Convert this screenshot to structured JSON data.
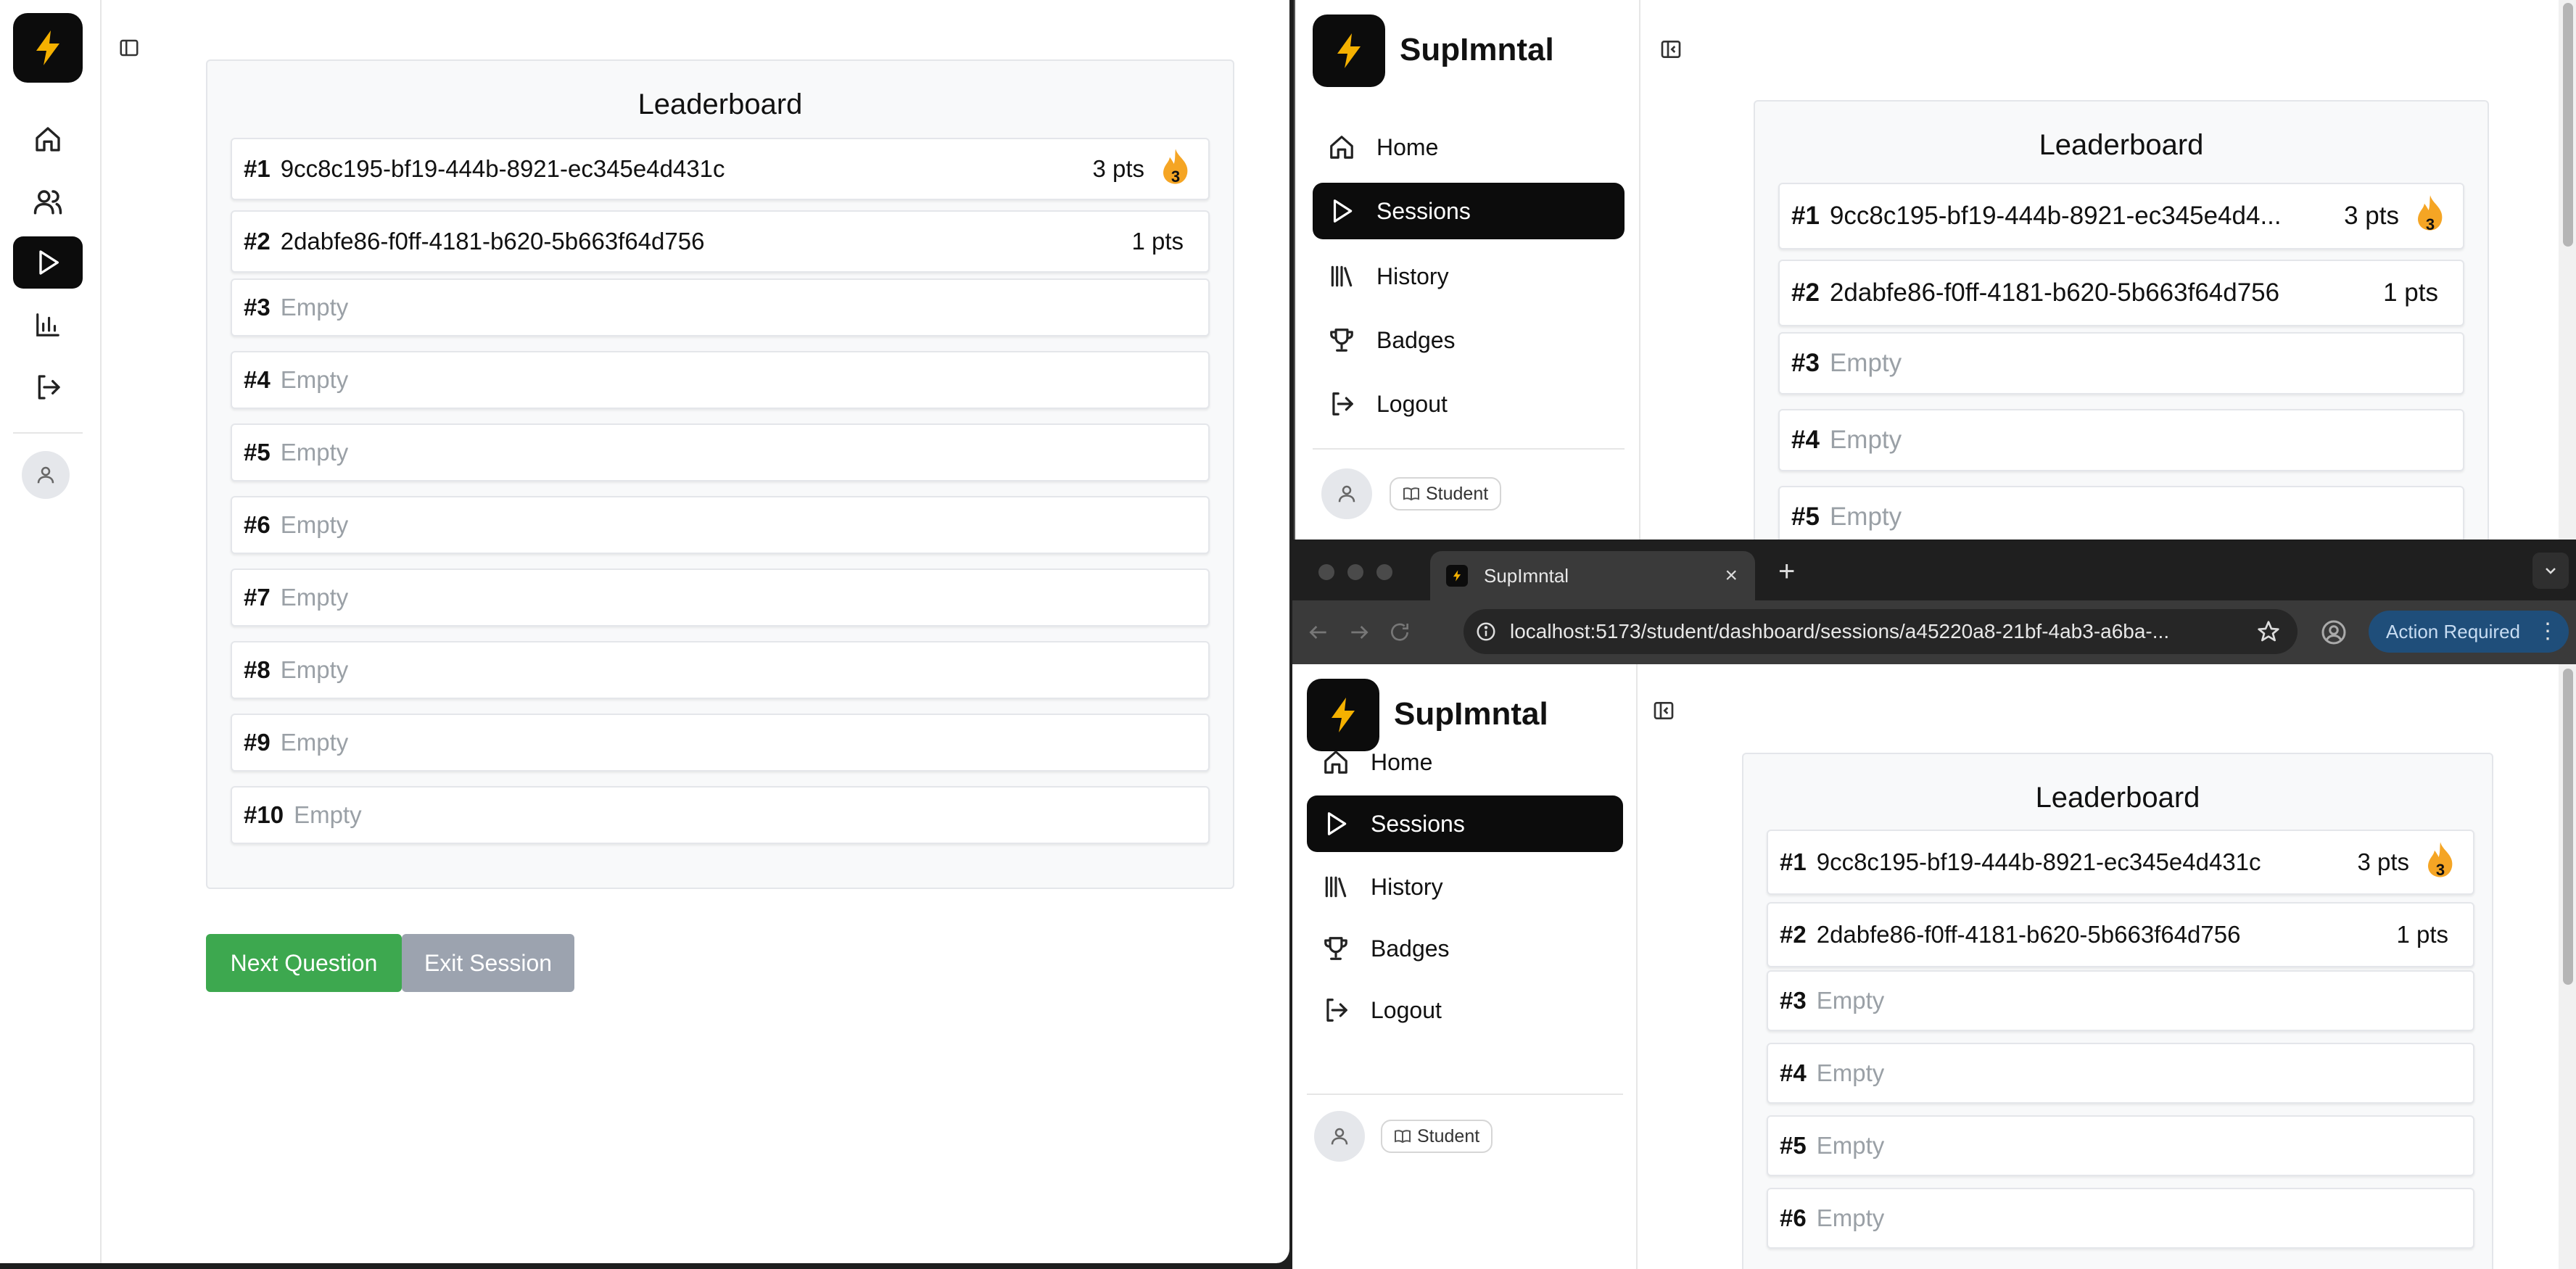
{
  "colors": {
    "brand_dark": "#0c0c0c",
    "primary_button": "#3da84f",
    "secondary_button": "#9ca3af",
    "bolt": "#f5b100",
    "streak_orange": "#f5a524",
    "action_required_bg": "#1f4e7a"
  },
  "app": {
    "name": "SupImntal",
    "logo_icon": "lightning-bolt-icon"
  },
  "nav": [
    {
      "label": "Home",
      "icon": "home-icon"
    },
    {
      "label": "Sessions",
      "icon": "play-icon",
      "active": true
    },
    {
      "label": "History",
      "icon": "library-icon"
    },
    {
      "label": "Badges",
      "icon": "trophy-icon"
    },
    {
      "label": "Logout",
      "icon": "logout-icon"
    }
  ],
  "user": {
    "role": "Student",
    "avatar_icon": "user-icon"
  },
  "leaderboard": {
    "title": "Leaderboard",
    "rows": [
      {
        "rank": "#1",
        "name": "9cc8c195-bf19-444b-8921-ec345e4d431c",
        "name_truncated": "9cc8c195-bf19-444b-8921-ec345e4d4...",
        "points": "3 pts",
        "streak": "3"
      },
      {
        "rank": "#2",
        "name": "2dabfe86-f0ff-4181-b620-5b663f64d756",
        "points": "1 pts"
      },
      {
        "rank": "#3",
        "name": "Empty"
      },
      {
        "rank": "#4",
        "name": "Empty"
      },
      {
        "rank": "#5",
        "name": "Empty"
      },
      {
        "rank": "#6",
        "name": "Empty"
      },
      {
        "rank": "#7",
        "name": "Empty"
      },
      {
        "rank": "#8",
        "name": "Empty"
      },
      {
        "rank": "#9",
        "name": "Empty"
      },
      {
        "rank": "#10",
        "name": "Empty"
      }
    ]
  },
  "actions": {
    "next_question": "Next Question",
    "exit_session": "Exit Session"
  },
  "browser": {
    "tab_title": "SupImntal",
    "url": "localhost:5173/student/dashboard/sessions/a45220a8-21bf-4ab3-a6ba-...",
    "action_required": "Action Required"
  }
}
